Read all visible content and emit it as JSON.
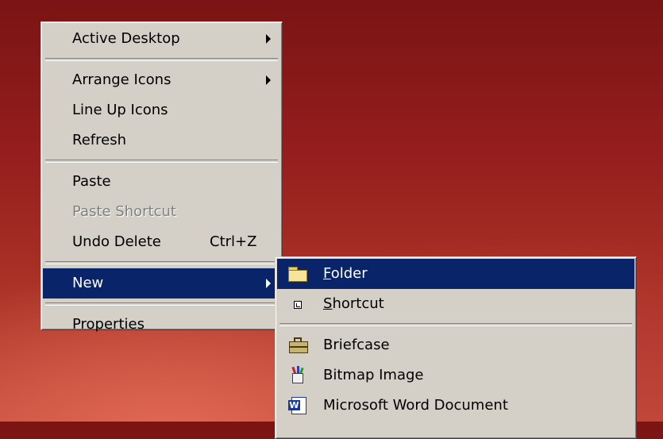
{
  "main_menu": {
    "active_desktop": "Active Desktop",
    "arrange_icons": "Arrange Icons",
    "line_up_icons": "Line Up Icons",
    "refresh": "Refresh",
    "paste": "Paste",
    "paste_shortcut": "Paste Shortcut",
    "undo_delete": "Undo Delete",
    "undo_delete_shortcut": "Ctrl+Z",
    "new": "New",
    "properties": "Properties"
  },
  "submenu": {
    "folder_mnemonic": "F",
    "folder_rest": "older",
    "shortcut_mnemonic": "S",
    "shortcut_rest": "hortcut",
    "briefcase": "Briefcase",
    "bitmap_image": "Bitmap Image",
    "word_document": "Microsoft Word Document"
  },
  "colors": {
    "menu_face": "#d4d0c8",
    "highlight": "#0a246a",
    "desktop": "#941d1d"
  },
  "icons": [
    "folder-icon",
    "shortcut-icon",
    "briefcase-icon",
    "bitmap-icon",
    "word-icon",
    "submenu-arrow-icon"
  ]
}
